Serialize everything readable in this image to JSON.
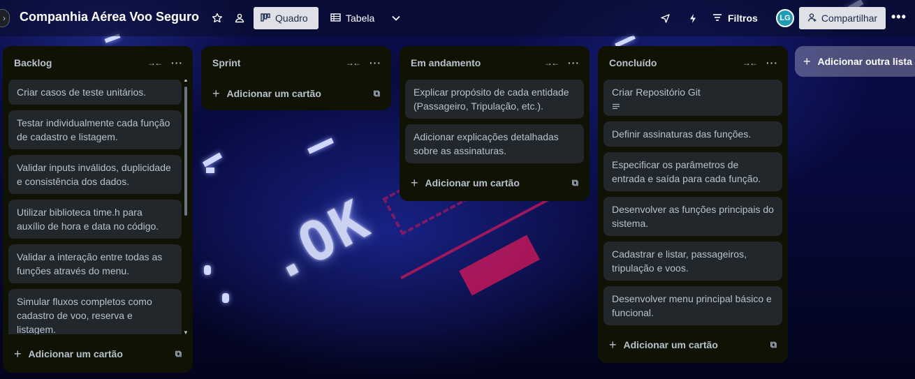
{
  "board": {
    "title": "Companhia Aérea Voo Seguro",
    "views": [
      {
        "label": "Quadro",
        "active": true
      },
      {
        "label": "Tabela",
        "active": false
      }
    ],
    "filters_label": "Filtros",
    "avatar_initials": "LG",
    "share_label": "Compartilhar",
    "add_list_label": "Adicionar outra lista",
    "background_text": ".OK"
  },
  "icons": {
    "star": "star-icon",
    "visibility": "people-icon",
    "quadro": "board-icon",
    "tabela": "table-icon",
    "chevron": "chevron-down-icon",
    "rocket": "power-ups-icon",
    "automation": "lightning-icon",
    "filter": "filter-icon",
    "share": "add-person-icon",
    "more": "more-icon"
  },
  "lists": [
    {
      "title": "Backlog",
      "cards": [
        "Criar casos de teste unitários.",
        "Testar individualmente cada função de cadastro e listagem.",
        "Validar inputs inválidos, duplicidade e consistência dos dados.",
        "Utilizar biblioteca time.h para auxílio de hora e data no código.",
        "Validar a interação entre todas as funções através do menu.",
        "Simular fluxos completos como cadastro de voo, reserva e listagem."
      ],
      "add_label": "Adicionar um cartão"
    },
    {
      "title": "Sprint",
      "cards": [],
      "add_label": "Adicionar um cartão"
    },
    {
      "title": "Em andamento",
      "cards": [
        "Explicar propósito de cada entidade (Passageiro, Tripulação, etc.).",
        "Adicionar explicações detalhadas sobre as assinaturas."
      ],
      "add_label": "Adicionar um cartão"
    },
    {
      "title": "Concluído",
      "cards": [
        "Criar Repositório Git",
        "Definir assinaturas das funções.",
        "Especificar os parâmetros de entrada e saída para cada função.",
        "Desenvolver as funções principais do sistema.",
        "Cadastrar e listar, passageiros, tripulação e voos.",
        "Desenvolver menu principal básico e funcional."
      ],
      "add_label": "Adicionar um cartão"
    }
  ]
}
